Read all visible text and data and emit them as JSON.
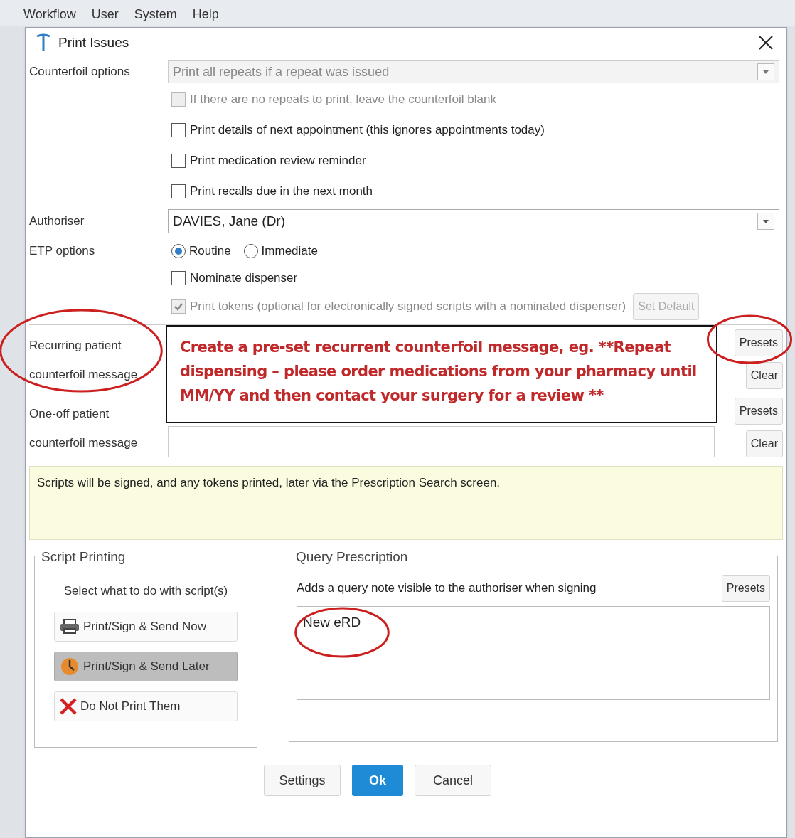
{
  "menu": [
    "Workflow",
    "User",
    "System",
    "Help"
  ],
  "dialog": {
    "title": "Print Issues"
  },
  "counterfoil_options": {
    "label": "Counterfoil options",
    "value": "Print all repeats if a repeat was issued",
    "disabled": true
  },
  "checkboxes": [
    {
      "label": "If there are no repeats to print, leave the counterfoil blank",
      "checked": false,
      "disabled": true
    },
    {
      "label": "Print details of next appointment (this ignores appointments today)",
      "checked": false,
      "disabled": false
    },
    {
      "label": "Print medication review reminder",
      "checked": false,
      "disabled": false
    },
    {
      "label": "Print recalls due in the next month",
      "checked": false,
      "disabled": false
    }
  ],
  "authoriser": {
    "label": "Authoriser",
    "value": "DAVIES, Jane (Dr)"
  },
  "etp": {
    "label": "ETP options",
    "options": [
      {
        "label": "Routine",
        "selected": true
      },
      {
        "label": "Immediate",
        "selected": false
      }
    ],
    "nominate": {
      "label": "Nominate dispenser",
      "checked": false,
      "disabled": false
    },
    "print_tokens": {
      "label": "Print tokens (optional for electronically signed scripts with a nominated dispenser)",
      "checked": true,
      "disabled": true
    },
    "set_default": {
      "label": "Set Default",
      "disabled": true
    }
  },
  "messages": [
    {
      "label_lines": [
        "Recurring patient",
        "counterfoil message"
      ],
      "buttons": [
        "Presets",
        "Clear"
      ]
    },
    {
      "label_lines": [
        "One-off patient",
        "counterfoil message"
      ],
      "buttons": [
        "Presets",
        "Clear"
      ]
    }
  ],
  "callout": "Create a pre-set recurrent counterfoil message, eg. **Repeat dispensing – please order medications from your pharmacy until MM/YY and then contact your surgery for a review **",
  "info": "Scripts will be signed, and any tokens printed, later via the Prescription Search screen.",
  "script_printing": {
    "title": "Script Printing",
    "prompt": "Select what to do with script(s)",
    "buttons": [
      {
        "kind": "print",
        "label": "Print/Sign & Send Now",
        "selected": false
      },
      {
        "kind": "later",
        "label": "Print/Sign & Send Later",
        "selected": true
      },
      {
        "kind": "none",
        "label": "Do Not Print Them",
        "selected": false
      }
    ]
  },
  "query": {
    "title": "Query Prescription",
    "description": "Adds a query note visible to the authoriser when signing",
    "presets": "Presets",
    "value": "New eRD"
  },
  "footer": [
    {
      "label": "Settings",
      "primary": false
    },
    {
      "label": "Ok",
      "primary": true
    },
    {
      "label": "Cancel",
      "primary": false
    }
  ]
}
